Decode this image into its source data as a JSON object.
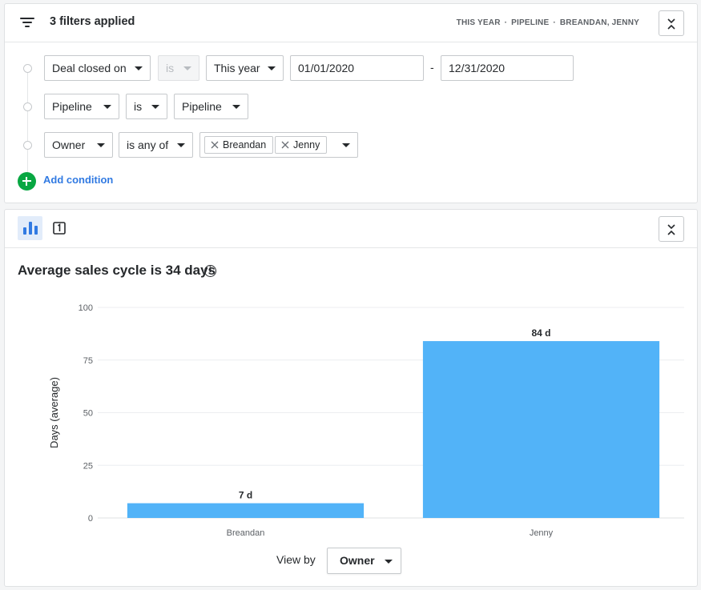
{
  "header": {
    "title": "3 filters applied",
    "summary": [
      "THIS YEAR",
      "PIPELINE",
      "BREANDAN, JENNY"
    ],
    "summary_separator": "·"
  },
  "conditions": [
    {
      "field": "Deal closed on",
      "operator": "is",
      "operator_disabled": true,
      "value": "This year",
      "date_from": "01/01/2020",
      "date_separator": "-",
      "date_to": "12/31/2020"
    },
    {
      "field": "Pipeline",
      "operator": "is",
      "value": "Pipeline"
    },
    {
      "field": "Owner",
      "operator": "is any of",
      "chips": [
        "Breandan",
        "Jenny"
      ]
    }
  ],
  "add_condition_label": "Add condition",
  "chart_section": {
    "title": "Average sales cycle is 34 days",
    "view_by_label": "View by",
    "view_by_value": "Owner"
  },
  "colors": {
    "accent": "#317ae2",
    "bar": "#52b3f8",
    "add": "#08a742"
  },
  "chart_data": {
    "type": "bar",
    "categories": [
      "Breandan",
      "Jenny"
    ],
    "values": [
      7,
      84
    ],
    "data_labels": [
      "7 d",
      "84 d"
    ],
    "ylabel": "Days (average)",
    "ylim": [
      0,
      100
    ],
    "yticks": [
      0,
      25,
      50,
      75,
      100
    ],
    "grid": true
  }
}
